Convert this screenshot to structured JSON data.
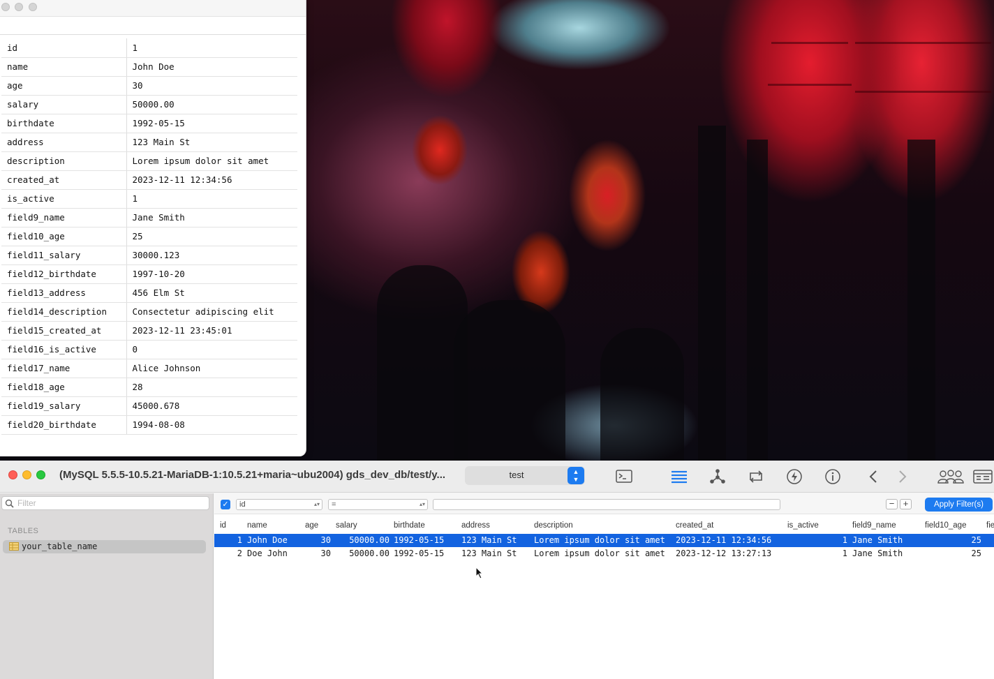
{
  "detail_window": {
    "fields": [
      {
        "key": "id",
        "value": "1"
      },
      {
        "key": "name",
        "value": "John Doe"
      },
      {
        "key": "age",
        "value": "30"
      },
      {
        "key": "salary",
        "value": "50000.00"
      },
      {
        "key": "birthdate",
        "value": "1992-05-15"
      },
      {
        "key": "address",
        "value": "123 Main St"
      },
      {
        "key": "description",
        "value": "Lorem ipsum dolor sit amet"
      },
      {
        "key": "created_at",
        "value": "2023-12-11 12:34:56"
      },
      {
        "key": "is_active",
        "value": "1"
      },
      {
        "key": "field9_name",
        "value": "Jane Smith"
      },
      {
        "key": "field10_age",
        "value": "25"
      },
      {
        "key": "field11_salary",
        "value": "30000.123"
      },
      {
        "key": "field12_birthdate",
        "value": "1997-10-20"
      },
      {
        "key": "field13_address",
        "value": "456 Elm St"
      },
      {
        "key": "field14_description",
        "value": "Consectetur adipiscing elit"
      },
      {
        "key": "field15_created_at",
        "value": "2023-12-11 23:45:01"
      },
      {
        "key": "field16_is_active",
        "value": "0"
      },
      {
        "key": "field17_name",
        "value": "Alice Johnson"
      },
      {
        "key": "field18_age",
        "value": "28"
      },
      {
        "key": "field19_salary",
        "value": "45000.678"
      },
      {
        "key": "field20_birthdate",
        "value": "1994-08-08"
      }
    ]
  },
  "main_window": {
    "title": "(MySQL 5.5.5-10.5.21-MariaDB-1:10.5.21+maria~ubu2004) gds_dev_db/test/y...",
    "database_select": "test",
    "toolbar_icons": [
      "console-icon",
      "list-icon",
      "structure-icon",
      "refresh-icon",
      "bolt-icon",
      "info-icon",
      "back-icon",
      "forward-icon",
      "users-icon",
      "window-icon"
    ]
  },
  "sidebar": {
    "filter_placeholder": "Filter",
    "tables_heading": "TABLES",
    "tables": [
      "your_table_name"
    ]
  },
  "filter_bar": {
    "field": "id",
    "operator": "=",
    "value": "",
    "minus": "−",
    "plus": "+",
    "apply_label": "Apply Filter(s)"
  },
  "grid": {
    "columns": [
      "id",
      "name",
      "age",
      "salary",
      "birthdate",
      "address",
      "description",
      "created_at",
      "is_active",
      "field9_name",
      "field10_age",
      "fie"
    ],
    "rows": [
      [
        "1",
        "John Doe",
        "30",
        "50000.00",
        "1992-05-15",
        "123 Main St",
        "Lorem ipsum dolor sit amet",
        "2023-12-11 12:34:56",
        "1",
        "Jane Smith",
        "25"
      ],
      [
        "2",
        "Doe John",
        "30",
        "50000.00",
        "1992-05-15",
        "123 Main St",
        "Lorem ipsum dolor sit amet",
        "2023-12-12 13:27:13",
        "1",
        "Jane Smith",
        "25"
      ]
    ],
    "selected_row": 0
  },
  "colors": {
    "accent": "#1d7bf0",
    "selection": "#1363e0",
    "close": "#ff5f57",
    "minimize": "#febc2e",
    "maximize": "#28c840"
  }
}
